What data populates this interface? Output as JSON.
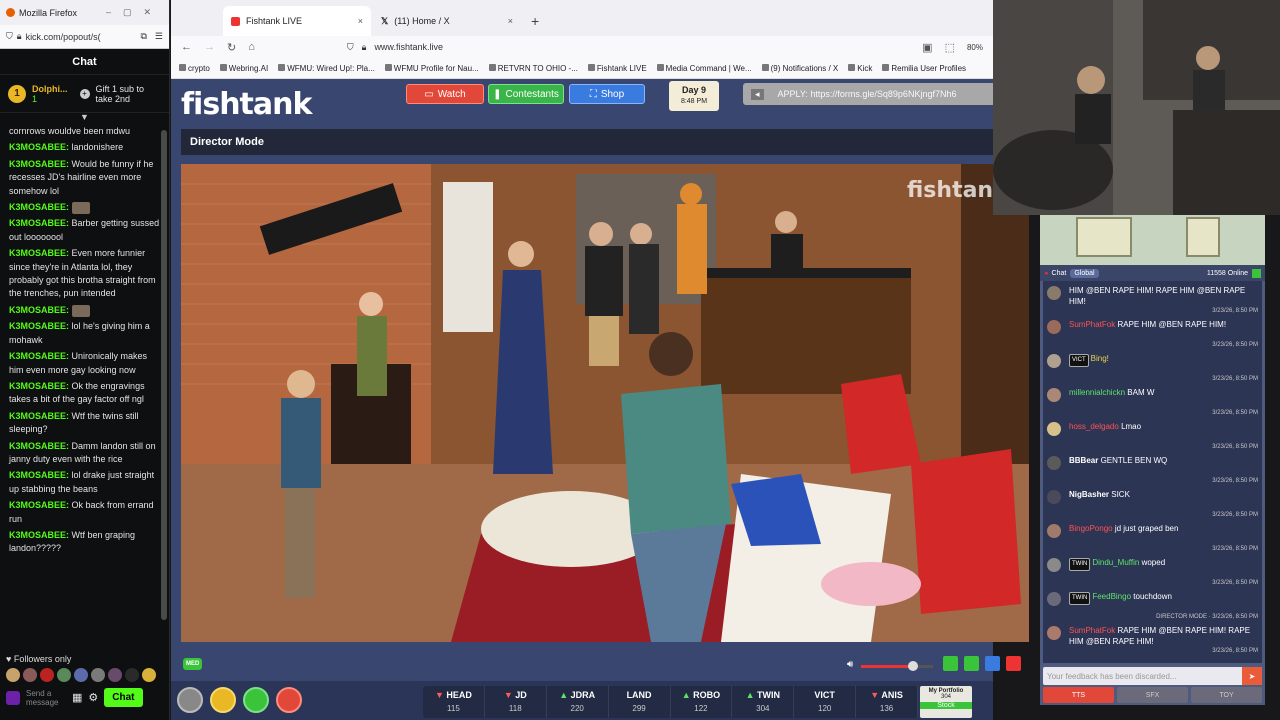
{
  "kick": {
    "window_title": "Mozilla Firefox",
    "url": "kick.com/popout/s(",
    "chat_title": "Chat",
    "pinned_user": "Dolphi...",
    "pinned_count": "1",
    "gift_text": "Gift 1 sub to take 2nd",
    "messages": [
      {
        "user": "",
        "text": "cornrows wouldve been mdwu"
      },
      {
        "user": "K3MOSABEE:",
        "text": "landonishere"
      },
      {
        "user": "K3MOSABEE:",
        "text": "Would be funny if he recesses JD's hairline even more somehow lol"
      },
      {
        "user": "K3MOSABEE:",
        "text": ""
      },
      {
        "user": "K3MOSABEE:",
        "text": "Barber getting sussed out loooooool"
      },
      {
        "user": "K3MOSABEE:",
        "text": "Even more funnier since they're in Atlanta lol, they probably got this brotha straight from the trenches, pun intended"
      },
      {
        "user": "K3MOSABEE:",
        "text": ""
      },
      {
        "user": "K3MOSABEE:",
        "text": "lol he's giving him a mohawk"
      },
      {
        "user": "K3MOSABEE:",
        "text": "Unironically makes him even more gay looking now"
      },
      {
        "user": "K3MOSABEE:",
        "text": "Ok the engravings takes a bit of the gay factor off ngl"
      },
      {
        "user": "K3MOSABEE:",
        "text": "Wtf the twins still sleeping?"
      },
      {
        "user": "K3MOSABEE:",
        "text": "Damm landon still on janny duty even with the rice"
      },
      {
        "user": "K3MOSABEE:",
        "text": "lol drake just straight up stabbing the beans"
      },
      {
        "user": "K3MOSABEE:",
        "text": "Ok back from errand run"
      },
      {
        "user": "K3MOSABEE:",
        "text": "Wtf ben graping landon?????"
      }
    ],
    "followers_only": "Followers only",
    "send_placeholder": "Send a message",
    "chat_button": "Chat"
  },
  "browser": {
    "tabs": [
      {
        "label": "Fishtank LIVE",
        "close": "×"
      },
      {
        "label": "(11) Home / X",
        "close": "×"
      }
    ],
    "new_tab": "+",
    "url": "www.fishtank.live",
    "zoom": "80%",
    "bookmarks": [
      "crypto",
      "Webring.AI",
      "WFMU: Wired Up!: Pla...",
      "WFMU Profile for Nau...",
      "RETVRN TO OHIO -...",
      "Fishtank LIVE",
      "Media Command | We...",
      "(9) Notifications / X",
      "Kick",
      "Remilia User Profiles"
    ]
  },
  "fishtank": {
    "logo": "fishtank",
    "nav": {
      "watch": "Watch",
      "contestants": "Contestants",
      "shop": "Shop"
    },
    "day_label": "Day 9",
    "day_time": "8:48 PM",
    "apply_text": "APPLY: https://forms.gle/Sq89p6NKjngf7Nh6",
    "director_mode": "Director Mode",
    "watermark": "fishtank",
    "med_badge": "MED",
    "contestants": [
      {
        "name": "HEAD",
        "value": "115",
        "dir": "down"
      },
      {
        "name": "JD",
        "value": "118",
        "dir": "down"
      },
      {
        "name": "JDRA",
        "value": "220",
        "dir": "up"
      },
      {
        "name": "LAND",
        "value": "299",
        "dir": "none"
      },
      {
        "name": "ROBO",
        "value": "122",
        "dir": "up"
      },
      {
        "name": "TWIN",
        "value": "304",
        "dir": "up"
      },
      {
        "name": "VICT",
        "value": "120",
        "dir": "none"
      },
      {
        "name": "ANIS",
        "value": "136",
        "dir": "down"
      }
    ],
    "portfolio_title": "My Portfolio",
    "portfolio_value": "304",
    "portfolio_label": "Stock",
    "volume_level": 0.72
  },
  "right_chat": {
    "tab_chat": "Chat",
    "tab_global": "Global",
    "online": "11558 Online",
    "messages": [
      {
        "user": "",
        "text": "HIM @BEN RAPE HIM! RAPE HIM @BEN RAPE HIM!",
        "time": "3/23/26, 8:50 PM",
        "color": "red"
      },
      {
        "user": "SumPhatFok",
        "text": "RAPE HIM @BEN RAPE HIM!",
        "time": "3/23/26, 8:50 PM",
        "color": "red"
      },
      {
        "user": "Bing!",
        "text": "",
        "time": "3/23/26, 8:50 PM",
        "color": "yel",
        "tag": "VICT"
      },
      {
        "user": "millennialchickn",
        "text": "BAM W",
        "time": "3/23/26, 8:50 PM",
        "color": "grn"
      },
      {
        "user": "hoss_delgado",
        "text": "Lmao",
        "time": "3/23/26, 8:50 PM",
        "color": "red"
      },
      {
        "user": "BBBear",
        "text": "GENTLE BEN WQ",
        "time": "3/23/26, 8:50 PM",
        "color": "white"
      },
      {
        "user": "NigBasher",
        "text": "SICK",
        "time": "3/23/26, 8:50 PM",
        "color": "white"
      },
      {
        "user": "BingoPongo",
        "text": "jd just graped ben",
        "time": "3/23/26, 8:50 PM",
        "color": "red"
      },
      {
        "user": "Dindu_Muffin",
        "text": "woped",
        "time": "3/23/26, 8:50 PM",
        "color": "grn",
        "tag": "TWIN"
      },
      {
        "user": "FeedBingo",
        "text": "touchdown",
        "time": "DIRECTOR MODE · 3/23/26, 8:50 PM",
        "color": "grn",
        "tag": "TWIN"
      },
      {
        "user": "SumPhatFok",
        "text": "RAPE HIM @BEN RAPE HIM! RAPE HIM @BEN RAPE HIM!",
        "time": "3/23/26, 8:50 PM",
        "color": "red"
      }
    ],
    "input_placeholder": "Your feedback has been discarded...",
    "btn_tts": "TTS",
    "btn_sfx": "SFX",
    "btn_toy": "TOY"
  }
}
